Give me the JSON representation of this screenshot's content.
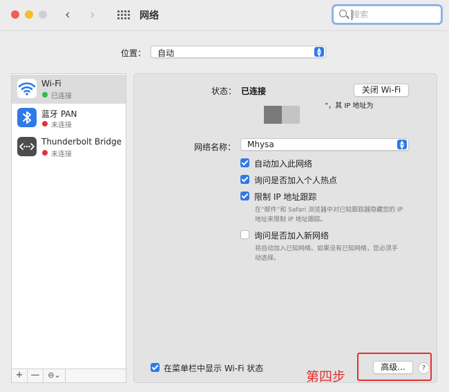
{
  "window": {
    "title": "网络",
    "search_placeholder": "搜索"
  },
  "location": {
    "label": "位置：",
    "value": "自动"
  },
  "sidebar": {
    "items": [
      {
        "name": "Wi-Fi",
        "status": "已连接",
        "status_color": "#2ebc4f",
        "icon": "wifi-icon",
        "selected": true
      },
      {
        "name": "蓝牙 PAN",
        "status": "未连接",
        "status_color": "#e0313c",
        "icon": "bluetooth-icon",
        "selected": false
      },
      {
        "name": "Thunderbolt Bridge",
        "status": "未连接",
        "status_color": "#e0313c",
        "icon": "thunderbolt-bridge-icon",
        "selected": false
      }
    ],
    "toolbar": {
      "add": "+",
      "remove": "—",
      "action": "⊖⌄"
    }
  },
  "detail": {
    "status_label": "状态：",
    "status_value": "已连接",
    "wifi_off_button": "关闭 Wi-Fi",
    "ip_note": "”，其 IP 地址为",
    "network_name_label": "网络名称：",
    "network_name_value": "Mhysa",
    "options": [
      {
        "label": "自动加入此网络",
        "checked": true
      },
      {
        "label": "询问是否加入个人热点",
        "checked": true
      },
      {
        "label": "限制 IP 地址跟踪",
        "checked": true,
        "hint_lines": [
          "在“邮件”和 Safari 浏览器中对已知跟踪器隐藏您的 IP",
          "地址来限制 IP 地址跟踪。"
        ]
      },
      {
        "label": "询问是否加入新网络",
        "checked": false,
        "hint_lines": [
          "将自动加入已知网络。如果没有已知网络，您必须手",
          "动选择。"
        ]
      }
    ],
    "menubar_option": {
      "label": "在菜单栏中显示 Wi-Fi 状态",
      "checked": true
    },
    "advanced_button": "高级...",
    "help_button": "?"
  },
  "annotation": {
    "step_text": "第四步",
    "color": "#e0312f"
  },
  "colors": {
    "accent": "#2f79e9",
    "connected": "#2ebc4f",
    "disconnected": "#e0313c"
  }
}
